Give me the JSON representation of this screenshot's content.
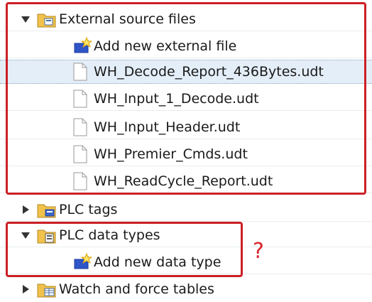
{
  "tree": {
    "external_source_files": {
      "label": "External source files",
      "icon": "folder-document-icon",
      "expanded": true,
      "add_item": "Add new external file",
      "files": [
        "WH_Decode_Report_436Bytes.udt",
        "WH_Input_1_Decode.udt",
        "WH_Input_Header.udt",
        "WH_Premier_Cmds.udt",
        "WH_ReadCycle_Report.udt"
      ],
      "selected_file": "WH_Decode_Report_436Bytes.udt"
    },
    "plc_tags": {
      "label": "PLC tags",
      "icon": "tags-folder-icon",
      "expanded": false
    },
    "plc_data_types": {
      "label": "PLC data types",
      "icon": "datatype-folder-icon",
      "expanded": true,
      "add_item": "Add new data type"
    },
    "watch_force_tables": {
      "label": "Watch and force tables",
      "icon": "table-folder-icon",
      "expanded": false
    }
  },
  "annotation": {
    "question_mark": "?"
  },
  "colors": {
    "highlight_border": "#cc1f24",
    "selection_bg": "#e4eef8",
    "folder": "#f0c24c",
    "add_icon_blue": "#2f55c8"
  }
}
